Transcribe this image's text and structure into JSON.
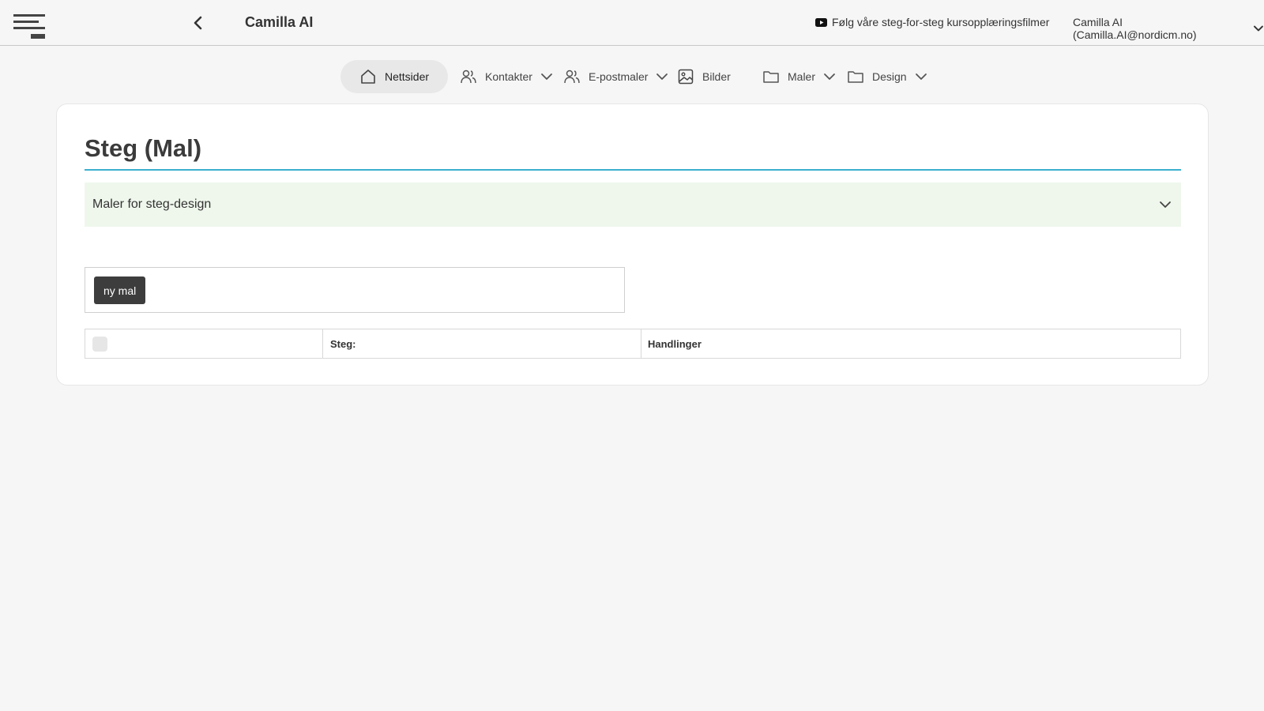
{
  "header": {
    "title": "Camilla AI",
    "video_link": "Følg våre steg-for-steg kursopplæringsfilmer",
    "user": "Camilla AI (Camilla.AI@nordicm.no)"
  },
  "nav": {
    "items": [
      {
        "label": "Nettsider",
        "icon": "home-icon",
        "active": true
      },
      {
        "label": "Kontakter",
        "icon": "users-icon",
        "dropdown": true
      },
      {
        "label": "E-postmaler",
        "icon": "users-icon",
        "dropdown": true
      },
      {
        "label": "Bilder",
        "icon": "image-icon"
      },
      {
        "label": "Maler",
        "icon": "folder-icon",
        "dropdown": true
      },
      {
        "label": "Design",
        "icon": "folder-icon",
        "dropdown": true
      }
    ]
  },
  "main": {
    "title": "Steg (Mal)",
    "accordion_label": "Maler for steg-design",
    "new_button": "ny mal",
    "table": {
      "columns": [
        "",
        "Steg:",
        "Handlinger"
      ]
    }
  },
  "colors": {
    "accent_line": "#3cb0cf",
    "accordion_bg": "#eff7ec",
    "button_bg": "#3d3d3d"
  }
}
